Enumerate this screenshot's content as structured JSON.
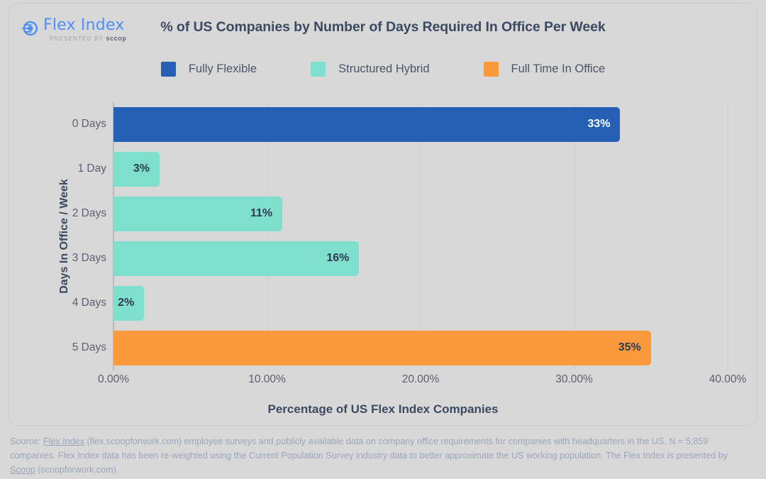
{
  "brand": {
    "name": "Flex Index",
    "tagline_prefix": "PRESENTED BY ",
    "tagline_brand": "sccop",
    "logo_icon": "flex-index-circle-icon",
    "accent": "#4f8ef7"
  },
  "chart_data": {
    "type": "bar",
    "orientation": "horizontal",
    "title": "% of US Companies by Number of Days Required In Office Per Week",
    "xlabel": "Percentage of US Flex Index Companies",
    "ylabel": "Days In Office / Week",
    "categories": [
      "0 Days",
      "1 Day",
      "2 Days",
      "3 Days",
      "4 Days",
      "5 Days"
    ],
    "values": [
      33,
      3,
      11,
      16,
      2,
      35
    ],
    "value_labels": [
      "33%",
      "3%",
      "11%",
      "16%",
      "2%",
      "35%"
    ],
    "series_of_point": [
      "Fully Flexible",
      "Structured Hybrid",
      "Structured Hybrid",
      "Structured Hybrid",
      "Structured Hybrid",
      "Full Time In Office"
    ],
    "bar_colors": [
      "#2560b4",
      "#7fdfcd",
      "#7fdfcd",
      "#7fdfcd",
      "#7fdfcd",
      "#fb9a3c"
    ],
    "label_colors": [
      "#ffffff",
      "#2d3b52",
      "#2d3b52",
      "#2d3b52",
      "#2d3b52",
      "#2d3b52"
    ],
    "xlim": [
      0,
      40
    ],
    "xticks": [
      0,
      10,
      20,
      30,
      40
    ],
    "xtick_labels": [
      "0.00%",
      "10.00%",
      "20.00%",
      "30.00%",
      "40.00%"
    ],
    "grid": true,
    "grid_axis": "x",
    "legend_position": "top-center",
    "legend": [
      {
        "label": "Fully Flexible",
        "color": "#2560b4"
      },
      {
        "label": "Structured Hybrid",
        "color": "#7fdfcd"
      },
      {
        "label": "Full Time In Office",
        "color": "#fb9a3c"
      }
    ]
  },
  "footnote": {
    "line": "Source: Flex Index (flex.scoopforwork.com) employee surveys and publicly available data on company office requirements for companies with headquarters in the US, N = 5,859 companies. Flex Index data has been re-weighted using the Current Population Survey industry data to better approximate the US working population. The Flex Index is presented by Scoop (scoopforwork.com).",
    "link_texts": [
      "Flex Index",
      "Scoop"
    ]
  }
}
